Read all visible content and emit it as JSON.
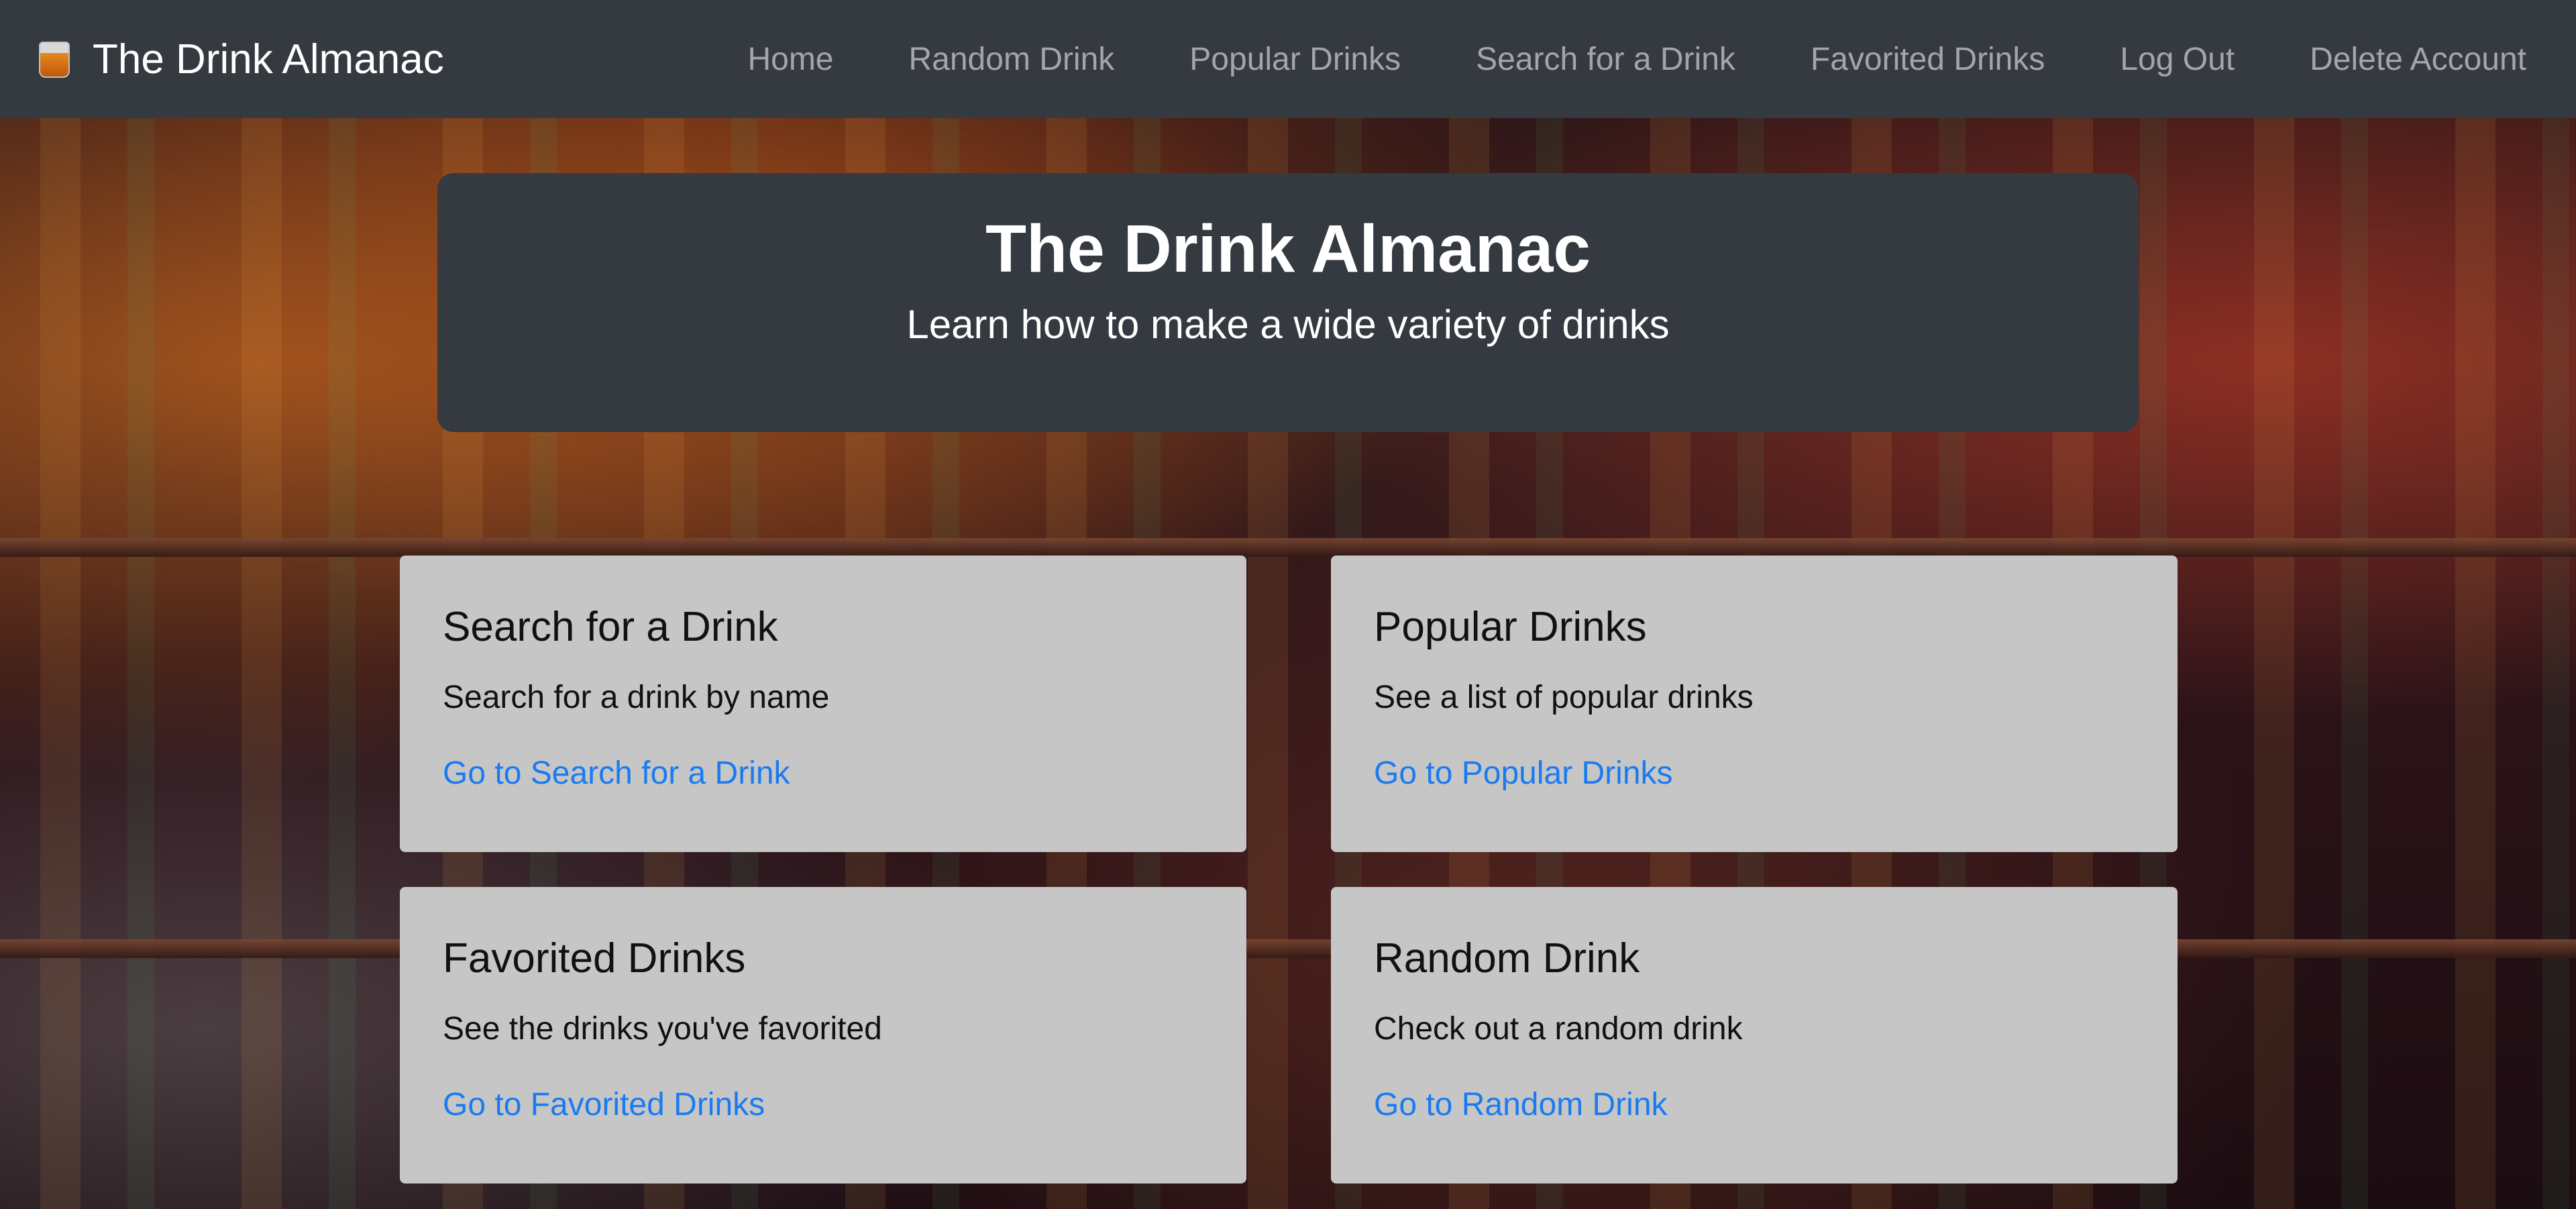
{
  "navbar": {
    "brand": "The Drink Almanac",
    "brand_icon": "cocktail-glass-icon",
    "links": [
      {
        "label": "Home"
      },
      {
        "label": "Random Drink"
      },
      {
        "label": "Popular Drinks"
      },
      {
        "label": "Search for a Drink"
      },
      {
        "label": "Favorited Drinks"
      },
      {
        "label": "Log Out"
      },
      {
        "label": "Delete Account"
      }
    ]
  },
  "hero": {
    "title": "The Drink Almanac",
    "subtitle": "Learn how to make a wide variety of drinks"
  },
  "cards": [
    {
      "title": "Search for a Drink",
      "text": "Search for a drink by name",
      "link": "Go to Search for a Drink"
    },
    {
      "title": "Popular Drinks",
      "text": "See a list of popular drinks",
      "link": "Go to Popular Drinks"
    },
    {
      "title": "Favorited Drinks",
      "text": "See the drinks you've favorited",
      "link": "Go to Favorited Drinks"
    },
    {
      "title": "Random Drink",
      "text": "Check out a random drink",
      "link": "Go to Random Drink"
    }
  ],
  "colors": {
    "navbar_bg": "#343a40",
    "card_bg": "#c6c6c6",
    "link": "#1a7bf0"
  }
}
